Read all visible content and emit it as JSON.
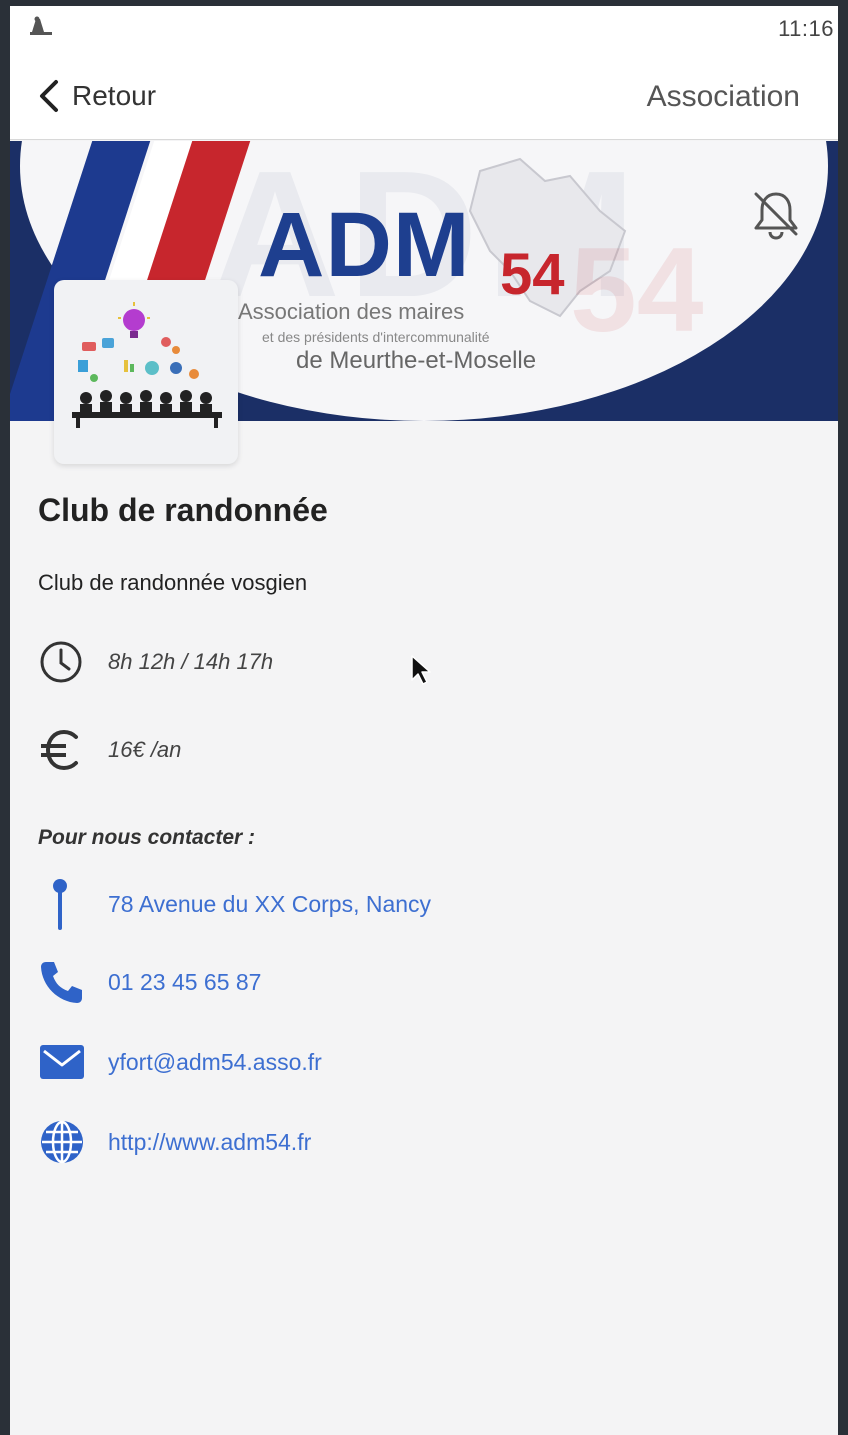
{
  "status_bar": {
    "time": "11:16",
    "notification_icon": "vlc-cone-icon"
  },
  "nav": {
    "back_label": "Retour",
    "title": "Association"
  },
  "banner": {
    "logo_main": "ADM",
    "logo_number": "54",
    "logo_line1": "Association des maires",
    "logo_line2": "et des présidents d'intercommunalité",
    "logo_line3": "de Meurthe-et-Moselle",
    "bell_icon": "bell-off-icon",
    "colors": {
      "navy": "#1b2f66",
      "blue": "#1e3f8f",
      "red": "#c7262d"
    }
  },
  "association": {
    "name": "Club de randonnée",
    "description": "Club de randonnée vosgien",
    "hours": "8h 12h / 14h 17h",
    "price": "16€ /an",
    "contact_heading": "Pour nous contacter :",
    "address": "78 Avenue du XX Corps, Nancy",
    "phone": "01 23 45 65 87",
    "email": "yfort@adm54.asso.fr",
    "website": "http://www.adm54.fr"
  },
  "accent_color": "#3d6fd1"
}
